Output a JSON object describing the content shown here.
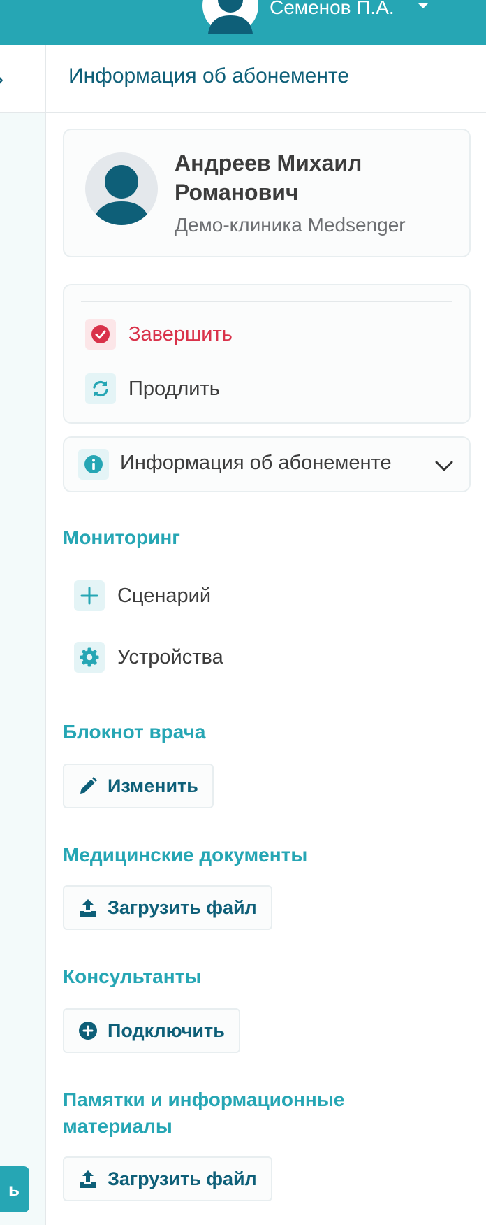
{
  "header": {
    "user_name": "Семенов П.А."
  },
  "panel": {
    "title": "Информация об абонементе"
  },
  "patient": {
    "name": "Андреев Михаил Романович",
    "clinic": "Демо-клиника Medsenger"
  },
  "actions": {
    "finish_label": "Завершить",
    "renew_label": "Продлить"
  },
  "info": {
    "label": "Информация об абонементе"
  },
  "monitoring": {
    "title": "Мониторинг",
    "items": [
      {
        "label": "Сценарий",
        "icon": "plus-icon"
      },
      {
        "label": "Устройства",
        "icon": "gear-icon"
      }
    ]
  },
  "notebook": {
    "title": "Блокнот врача",
    "button_label": "Изменить"
  },
  "medical_docs": {
    "title": "Медицинские документы",
    "button_label": "Загрузить файл"
  },
  "consultants": {
    "title": "Консультанты",
    "button_label": "Подключить"
  },
  "materials": {
    "title": "Памятки и информационные материалы",
    "button_label": "Загрузить файл"
  },
  "left_strip": {
    "button_label": "ь"
  },
  "colors": {
    "primary": "#26a6b4",
    "dark_teal": "#0e5f78",
    "danger": "#d9324a"
  }
}
